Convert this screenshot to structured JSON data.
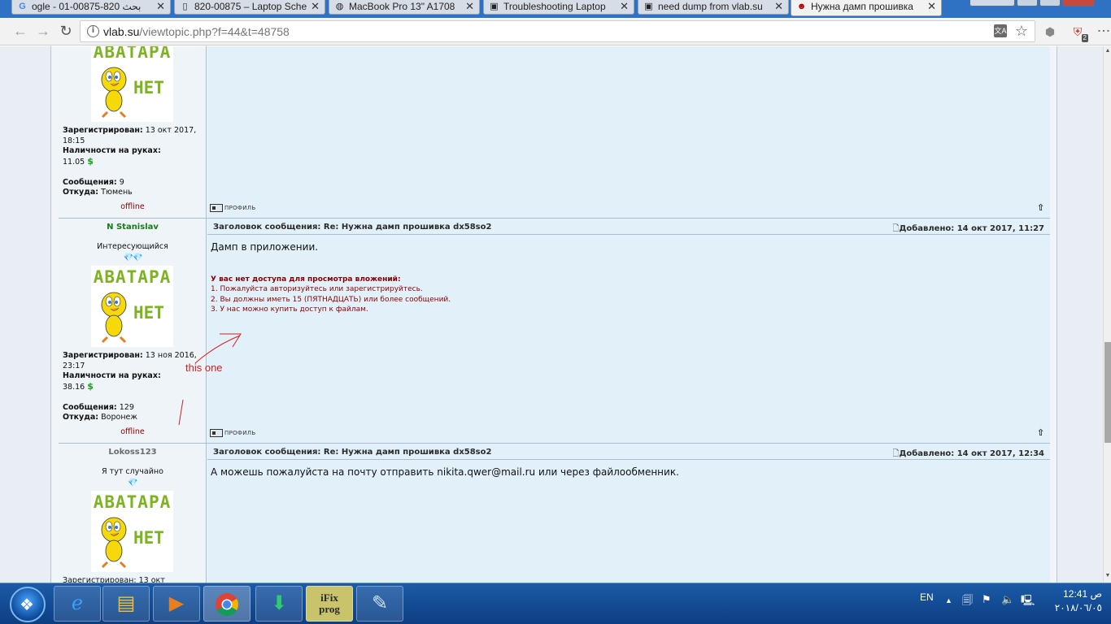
{
  "browser": {
    "tabs": [
      {
        "title": "ogle - بحث 820-00875-01",
        "favicon": "G"
      },
      {
        "title": "820-00875 – Laptop Sche",
        "favicon": "doc"
      },
      {
        "title": "MacBook Pro 13\" A1708",
        "favicon": "apple"
      },
      {
        "title": "Troubleshooting Laptop",
        "favicon": "doc"
      },
      {
        "title": "need dump from vlab.su",
        "favicon": "doc"
      },
      {
        "title": "Нужна дамп прошивка",
        "favicon": "hacker"
      }
    ],
    "active_tab": 5,
    "close_glyph": "✕",
    "url_host": "vlab.su",
    "url_path": "/viewtopic.php?f=44&t=48758",
    "extension_badge": "2"
  },
  "posts": [
    {
      "registered_label": "Зарегистрирован:",
      "registered_value": "13 окт 2017, 18:15",
      "cash_label": "Наличности на руках:",
      "cash_value": "11.05",
      "messages_label": "Сообщения:",
      "messages_value": "9",
      "from_label": "Откуда:",
      "from_value": "Тюмень",
      "status": "offline",
      "profile_label": "ПРОФИЛЬ"
    },
    {
      "nick": "N Stanislav",
      "rank": "Интересующийся",
      "rank_gems": "💎💎",
      "subject_label": "Заголовок сообщения:",
      "subject": "Re: Нужна дамп прошивка dx58so2",
      "posted_label": "Добавлено:",
      "posted": "14 окт 2017, 11:27",
      "message": "Дамп в приложении.",
      "warning_title": "У вас нет доступа для просмотра вложений:",
      "warning_lines": [
        "1. Пожалуйста авторизуйтесь или зарегистрируйтесь.",
        "2. Вы должны иметь 15 (ПЯТНАДЦАТЬ) или более сообщений.",
        "3. У нас можно купить доступ к файлам."
      ],
      "registered_label": "Зарегистрирован:",
      "registered_value": "13 ноя 2016, 23:17",
      "cash_label": "Наличности на руках:",
      "cash_value": "38.16",
      "messages_label": "Сообщения:",
      "messages_value": "129",
      "from_label": "Откуда:",
      "from_value": "Воронеж",
      "status": "offline",
      "profile_label": "ПРОФИЛЬ"
    },
    {
      "nick": "Lokoss123",
      "rank": "Я тут случайно",
      "rank_gems": "💎",
      "subject_label": "Заголовок сообщения:",
      "subject": "Re: Нужна дамп прошивка dx58so2",
      "posted_label": "Добавлено:",
      "posted": "14 окт 2017, 12:34",
      "message": "А можешь пожалуйста на почту отправить nikita.qwer@mail.ru или через файлообменник.",
      "registered_partial": "Зарегистрирован: 13 окт"
    }
  ],
  "avatar": {
    "line1": "АВАТАРА",
    "line2": "НЕТ"
  },
  "currency_symbol": "$",
  "annotation": "this one",
  "colors": {
    "annotation": "#d42020",
    "nick_active": "#1a7a1a",
    "nick_inactive": "#6a6a6a",
    "warning": "#8b0000",
    "taskbar": "#0d3e82"
  },
  "taskbar": {
    "apps": [
      "internet-explorer-icon",
      "file-explorer-icon",
      "media-player-icon",
      "chrome-icon",
      "downloader-icon",
      "ifixprog-icon",
      "notepad-icon"
    ],
    "ifix_label_1": "iFix",
    "ifix_label_2": "prog",
    "language": "EN",
    "time": "12:41 ص",
    "date": "٢٠١٨/٠٦/٠٥"
  }
}
